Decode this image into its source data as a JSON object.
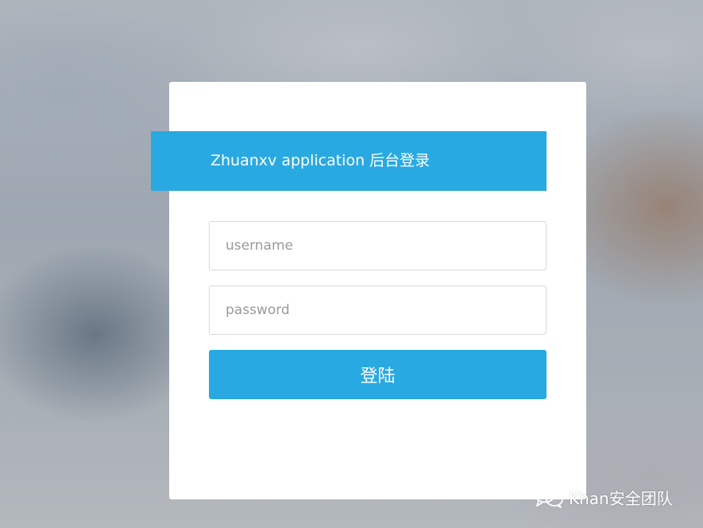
{
  "login": {
    "title": "Zhuanxv application 后台登录",
    "username_placeholder": "username",
    "password_placeholder": "password",
    "submit_label": "登陆"
  },
  "watermark": {
    "icon": "wechat-icon",
    "text": "Khan安全团队"
  },
  "colors": {
    "accent": "#29a9e1",
    "card": "#ffffff"
  }
}
